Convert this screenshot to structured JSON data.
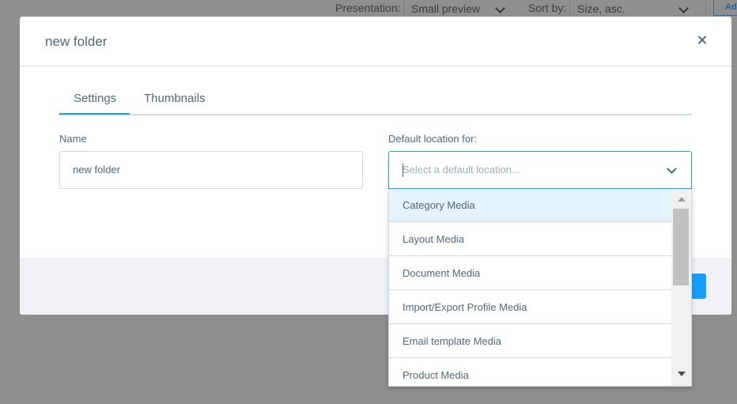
{
  "background_toolbar": {
    "presentation_label": "Presentation:",
    "presentation_value": "Small preview",
    "sort_label": "Sort by:",
    "sort_value": "Size, asc.",
    "add_button_label": "Ad"
  },
  "modal": {
    "title": "new folder",
    "close_icon": "close-icon",
    "tabs": [
      {
        "label": "Settings",
        "active": true
      },
      {
        "label": "Thumbnails",
        "active": false
      }
    ],
    "name_field": {
      "label": "Name",
      "value": "new folder"
    },
    "default_location": {
      "label": "Default location for:",
      "placeholder": "Select a default location...",
      "options": [
        "Category Media",
        "Layout Media",
        "Document Media",
        "Import/Export Profile Media",
        "Email template Media",
        "Product Media"
      ],
      "highlighted_option": "Category Media"
    }
  },
  "colors": {
    "accent": "#189eff",
    "overlay": "#8f8f8f",
    "text": "#52667a",
    "highlight": "#e4f2fc",
    "footer": "#f0f2f5"
  }
}
